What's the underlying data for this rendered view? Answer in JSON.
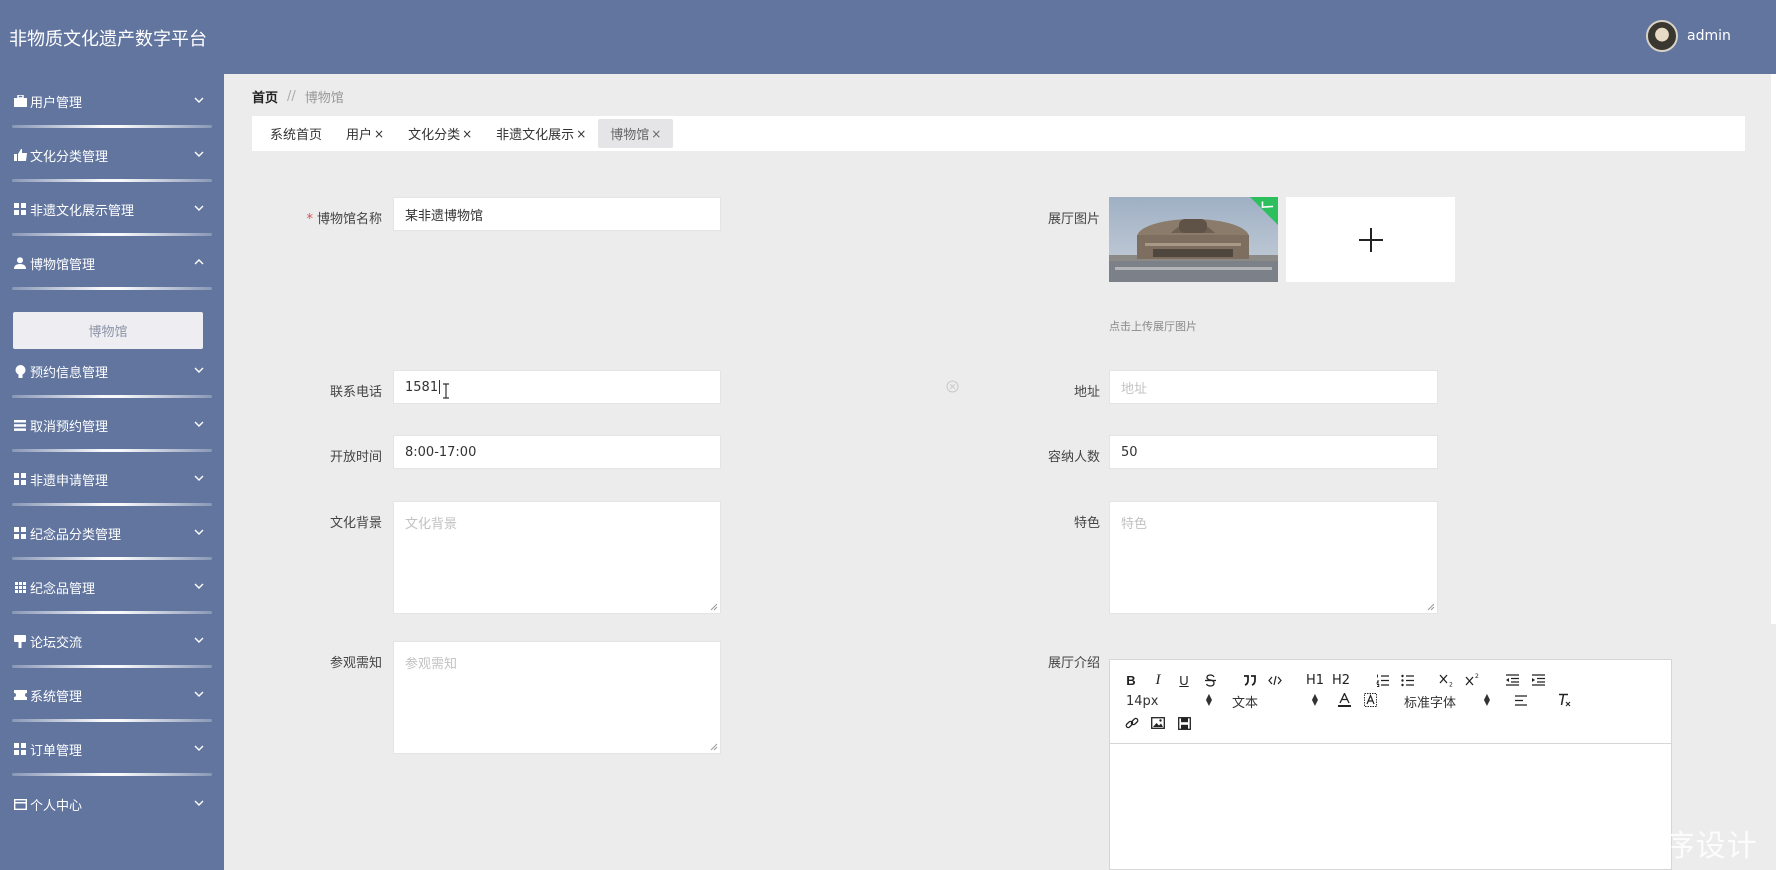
{
  "header": {
    "title": "非物质文化遗产数字平台",
    "username": "admin"
  },
  "sidebar": {
    "items": [
      {
        "label": "用户管理"
      },
      {
        "label": "文化分类管理"
      },
      {
        "label": "非遗文化展示管理"
      },
      {
        "label": "博物馆管理"
      },
      {
        "label": "预约信息管理"
      },
      {
        "label": "取消预约管理"
      },
      {
        "label": "非遗申请管理"
      },
      {
        "label": "纪念品分类管理"
      },
      {
        "label": "纪念品管理"
      },
      {
        "label": "论坛交流"
      },
      {
        "label": "系统管理"
      },
      {
        "label": "订单管理"
      },
      {
        "label": "个人中心"
      }
    ],
    "submenu_active": "博物馆"
  },
  "breadcrumb": {
    "home": "首页",
    "sep": "//",
    "current": "博物馆"
  },
  "tabs": [
    {
      "label": "系统首页",
      "closable": ""
    },
    {
      "label": "用户",
      "closable": "×"
    },
    {
      "label": "文化分类",
      "closable": "×"
    },
    {
      "label": "非遗文化展示",
      "closable": "×"
    },
    {
      "label": "博物馆",
      "closable": "×"
    }
  ],
  "form": {
    "name_label": "博物馆名称",
    "name_value": "某非遗博物馆",
    "phone_label": "联系电话",
    "phone_value": "1581",
    "open_label": "开放时间",
    "open_value": "8:00-17:00",
    "background_label": "文化背景",
    "background_placeholder": "文化背景",
    "notice_label": "参观需知",
    "notice_placeholder": "参观需知",
    "image_label": "展厅图片",
    "upload_hint": "点击上传展厅图片",
    "address_label": "地址",
    "address_placeholder": "地址",
    "capacity_label": "容纳人数",
    "capacity_value": "50",
    "feature_label": "特色",
    "feature_placeholder": "特色",
    "intro_label": "展厅介绍"
  },
  "editor": {
    "bold": "B",
    "italic": "I",
    "underline": "U",
    "h1": "H1",
    "h2": "H2",
    "font_size": "14px",
    "text_type": "文本",
    "font_family": "标准字体"
  },
  "watermark": "CSDN @ ゛小许程序设计"
}
